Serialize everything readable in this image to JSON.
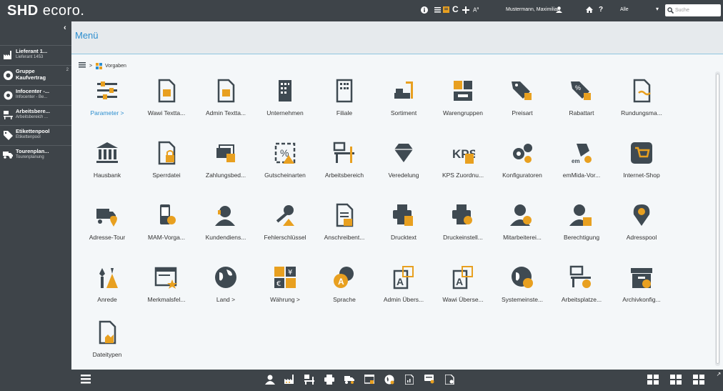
{
  "app": {
    "logo_bold": "SHD",
    "logo_thin": "ecoro.",
    "user_name": "Mustermann, Maximilian",
    "filter_value": "Alle",
    "search_placeholder": "Suche"
  },
  "sidebar": {
    "items": [
      {
        "title": "Lieferant 1...",
        "subtitle": "Lieferant 1453",
        "icon": "factory-icon"
      },
      {
        "title": "Gruppe",
        "title2": "Kaufvertrag",
        "badge": "2",
        "icon": "contract-icon"
      },
      {
        "title": "Infocenter -...",
        "subtitle": "Infocenter - Be...",
        "icon": "info-gear-icon"
      },
      {
        "title": "Arbeitsbere...",
        "subtitle": "Arbeitsbereich ...",
        "icon": "workplace-icon"
      },
      {
        "title": "Etikettenpool",
        "subtitle": "Etikettenpool",
        "icon": "tag-icon"
      },
      {
        "title": "Tourenplan...",
        "subtitle": "Tourenplanung",
        "icon": "truck-icon"
      }
    ]
  },
  "main": {
    "title": "Menü",
    "breadcrumb": {
      "separator": ">",
      "current": "Vorgaben"
    },
    "tiles": [
      "Parameter >",
      "Wawi Textta...",
      "Admin Textta...",
      "Unternehmen",
      "Filiale",
      "Sortiment",
      "Warengruppen",
      "Preisart",
      "Rabattart",
      "Rundungsma...",
      "Hausbank",
      "Sperrdatei",
      "Zahlungsbed...",
      "Gutscheinarten",
      "Arbeitsbereich",
      "Veredelung",
      "KPS Zuordnu...",
      "Konfiguratoren",
      "emMida-Vor...",
      "Internet-Shop",
      "Adresse-Tour",
      "MAM-Vorga...",
      "Kundendiens...",
      "Fehlerschlüssel",
      "Anschreibent...",
      "Drucktext",
      "Druckeinstell...",
      "Mitarbeiterei...",
      "Berechtigung",
      "Adresspool",
      "Anrede",
      "Merkmalsfel...",
      "Land >",
      "Währung >",
      "Sprache",
      "Admin Übers...",
      "Wawi Überse...",
      "Systemeinste...",
      "Arbeitsplatze...",
      "Archivkonfig...",
      "Dateitypen"
    ]
  },
  "colors": {
    "accent": "#2c8ecf",
    "icon_dark": "#3f4a52",
    "icon_orange": "#e8a020",
    "bar_bg": "#3e4449"
  }
}
